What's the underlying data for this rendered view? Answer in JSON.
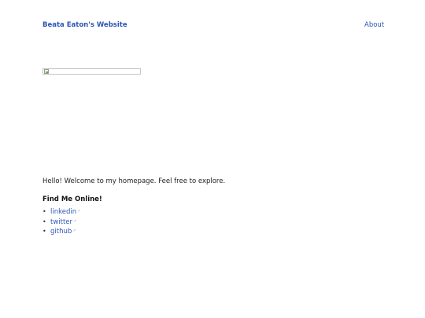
{
  "header": {
    "site_title": "Beata Eaton's Website",
    "nav": [
      {
        "label": "About"
      }
    ]
  },
  "main": {
    "intro_text": "Hello! Welcome to my homepage. Feel free to explore.",
    "find_heading": "Find Me Online!",
    "links": [
      {
        "label": "linkedin",
        "icon": "external-link-icon"
      },
      {
        "label": "twitter",
        "icon": "external-link-icon"
      },
      {
        "label": "github",
        "icon": "external-link-icon"
      }
    ]
  },
  "colors": {
    "link": "#2d55b8",
    "text": "#222222",
    "background": "#ffffff"
  }
}
